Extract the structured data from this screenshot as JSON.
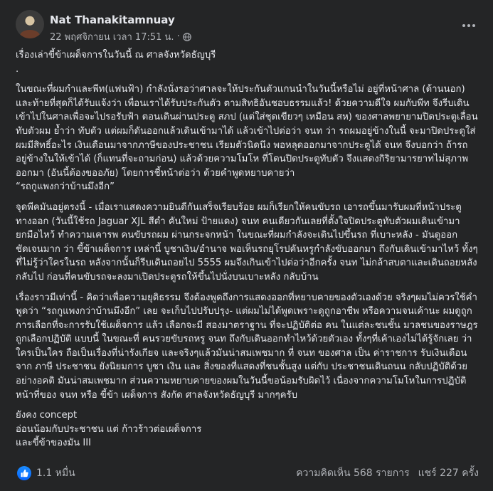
{
  "post": {
    "author": "Nat Thanakitamnuay",
    "timestamp": "22 พฤศจิกายน เวลา 17:51 น.",
    "separator": "·",
    "paragraphs": [
      "เรื่องเล่าขี้ข้าเผด็จการในวันนี้ ณ ศาลจังหวัดธัญบุรี\n.",
      "ในขณะที่ผมกำและพีท(แฟนฟ้า) กำลังนั่งรอว่าศาลจะให้ประกันตัวแกนนำในวันนี้หรือไม่ อยู่ที่หน้าศาล (ด้านนอก) และท้ายที่สุดก็ได้รับแจ้งว่า เพื่อนเราได้รับประกันตัว ตามสิทธิอันชอบธรรมแล้ว! ด้วยความดีใจ ผมกับพีท จึงรีบเดินเข้าไปในศาลเพื่อจะไปรอรับฟ้า ตอนเดินผ่านประตู สภป (แต่ใส่ชุดเขียวๆ เหมือน สห) ของศาลพยายามปิดประตูเลื่อนทับตัวผม ย้ำว่า ทับตัว แต่ผมก็ดันออกแล้วเดินเข้ามาได้ แล้วเข้าไปต่อว่า จนท ว่า รถผมอยู่ข้างในนี้ จะมาปิดประตูใส่ผมมีสิทธิ์อะไร เงินเดือนมาจากภาษีของประชาชน เรียมตัวนิดนึง พอหลุดออกมาจากประตูได้ จนท จึงบอกว่า ถ้ารถอยู่ข้างในให้เข้าได้ (ก็แทนที่จะถามก่อน) แล้วด้วยความโมโห ที่โดนปิดประตูทับตัว จึงแสดงกิริยามารยาทไม่สุภาพออกมา (อันนี้ต้องขออภัย) โดยการชี้หน้าต่อว่า ด้วยคำพูดหยาบคายว่า",
      "“รถกูแพงกว่าบ้านมึงอีก”",
      "จุดพีคมันอยู่ตรงนี้ - เมื่อเราแสดงความยินดีกันเสร็จเรียบร้อย ผมก็เรียกให้คนขับรถ เอารถขึ้นมารับผมที่หน้าประตูทางออก (วันนี้ใช้รถ Jaguar XJL สีดำ คันใหม่ ป้ายแดง) จนท คนเดียวกันเลยที่ตั้งใจปิดประตูทับตัวผมเดินเข้ามา ยกมือไหว้ ทำความเคารพ คนขับรถผม ผ่านกระจกหน้า ในขณะที่ผมกำลังจะเดินไปขึ้นรถ ที่เบาะหลัง - มันดูออกชัดเจนมาก ว่า ขี้ข้าเผด็จการ เหล่านี้ บูชาเงิน/อำนาจ พอเห็นรถยุโรปคันหรูกำลังขับออกมา ถึงกับเดินเข้ามาไหว้ ทั้งๆที่ไม่รู้ว่าใครในรถ หลังจากนั้นก็รีบเดินถอยไป 5555 ผมจึงเกินเข้าไปต่อว่าอีกครั้ง จนท ไม่กล้าสบตาและเดินถอยหลังกลับไป ก่อนที่คนขับรถจะลงมาเปิดประตูรถให้ขึ้นไปนั่งบนเบาะหลัง กลับบ้าน",
      "เรื่องราวมีเท่านี้ - คิดว่าเพื่อความยุติธรรม จึงต้องพูดถึงการแสดงออกที่หยาบคายของตัวเองด้วย จริงๆผมไม่ควรใช้คำพูดว่า “รถกูแพงกว่าบ้านมึงอีก” เลย จะเก็บไปปรับปรุง- แต่ผมไม่ได้พูดเพราะดูถูกอาชีพ หรือความจนเค้านะ ผมดูถูกการเลือกที่จะการรับใช้เผด็จการ แล้ว เลือกจะมี สองมาตราฐาน ที่จะปฏิบัติต่อ คน ในแต่ละชนชั้น มวลชนของราษฎร ถูกเลือกปฏิบัติ แบบนี้ ในขณะที่ คนรวยขับรถหรู จนท ถึงกับเดินออกทำไหว้ด้วยตัวเอง ทั้งๆที่เค้าเองไม่ได้รู้จักเลย ว่าใครเป็นใคร ถือเป็นเรื่องที่น่ารังเกียจ และจริงๆแล้วมันน่าสมเพชมาก ที่ จนท ของศาล เป็น ค่าราชการ รับเงินเดือนจาก ภาษี ประชาชน ยังนิยมการ บูชา เงิน และ สิ่งของที่แสดงที่ชนชั้นสูง แต่กับ ประชาชนเดินถนน กลับปฏิบัติด้วยอย่างอคติ มันน่าสมเพชมาก ส่วนความหยาบคายของผมในวันนี้ขอน้อมรับผิดไว้ เนื่องจากความโมโหในการปฏิบัติหน้าที่ของ จนท หรือ ขี้ข้า เผด็จการ สังกัด ศาลจังหวัดธัญบุรี มากๆครับ",
      "ยังคง concept\nอ่อนน้อมกับประชาชน แต่ ก้าวร้าวต่อเผด็จการ\nและขี้ข้าของมัน III"
    ]
  },
  "footer": {
    "reaction_count": "1.1 หมื่น",
    "comments": "ความคิดเห็น 568 รายการ",
    "shares": "แชร์ 227 ครั้ง"
  },
  "colors": {
    "background": "#242526",
    "text": "#e4e6eb",
    "secondary": "#b0b3b8",
    "like_blue": "#0866ff"
  }
}
